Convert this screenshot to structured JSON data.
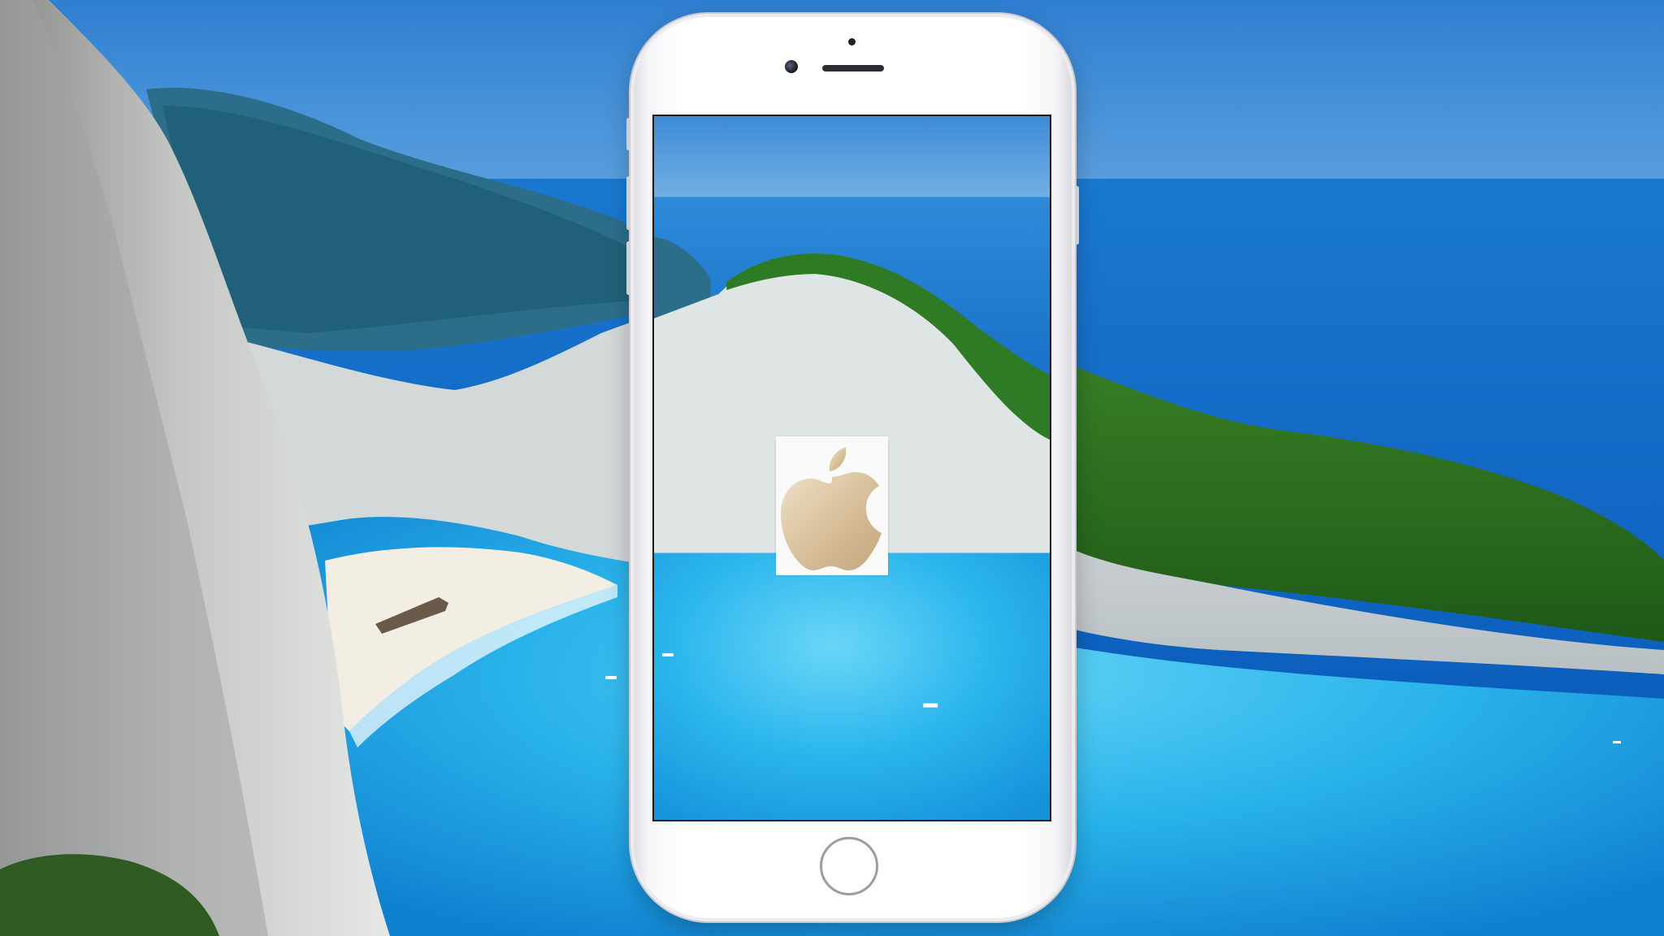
{
  "image": {
    "subject": "smartphone-mockup-over-beach-cove",
    "icons": [
      "front-camera-icon",
      "home-button-icon",
      "apple-logo-icon"
    ],
    "colors": {
      "sky": "#3f86d1",
      "sea": "#0b5cbf",
      "lagoon": "#2ab6ea",
      "cliff": "#d8dde0",
      "vegetation": "#2e6a1e",
      "sand": "#f1ece2",
      "phone_body": "#ffffff",
      "logo_gold": "#d8c2a0"
    }
  }
}
